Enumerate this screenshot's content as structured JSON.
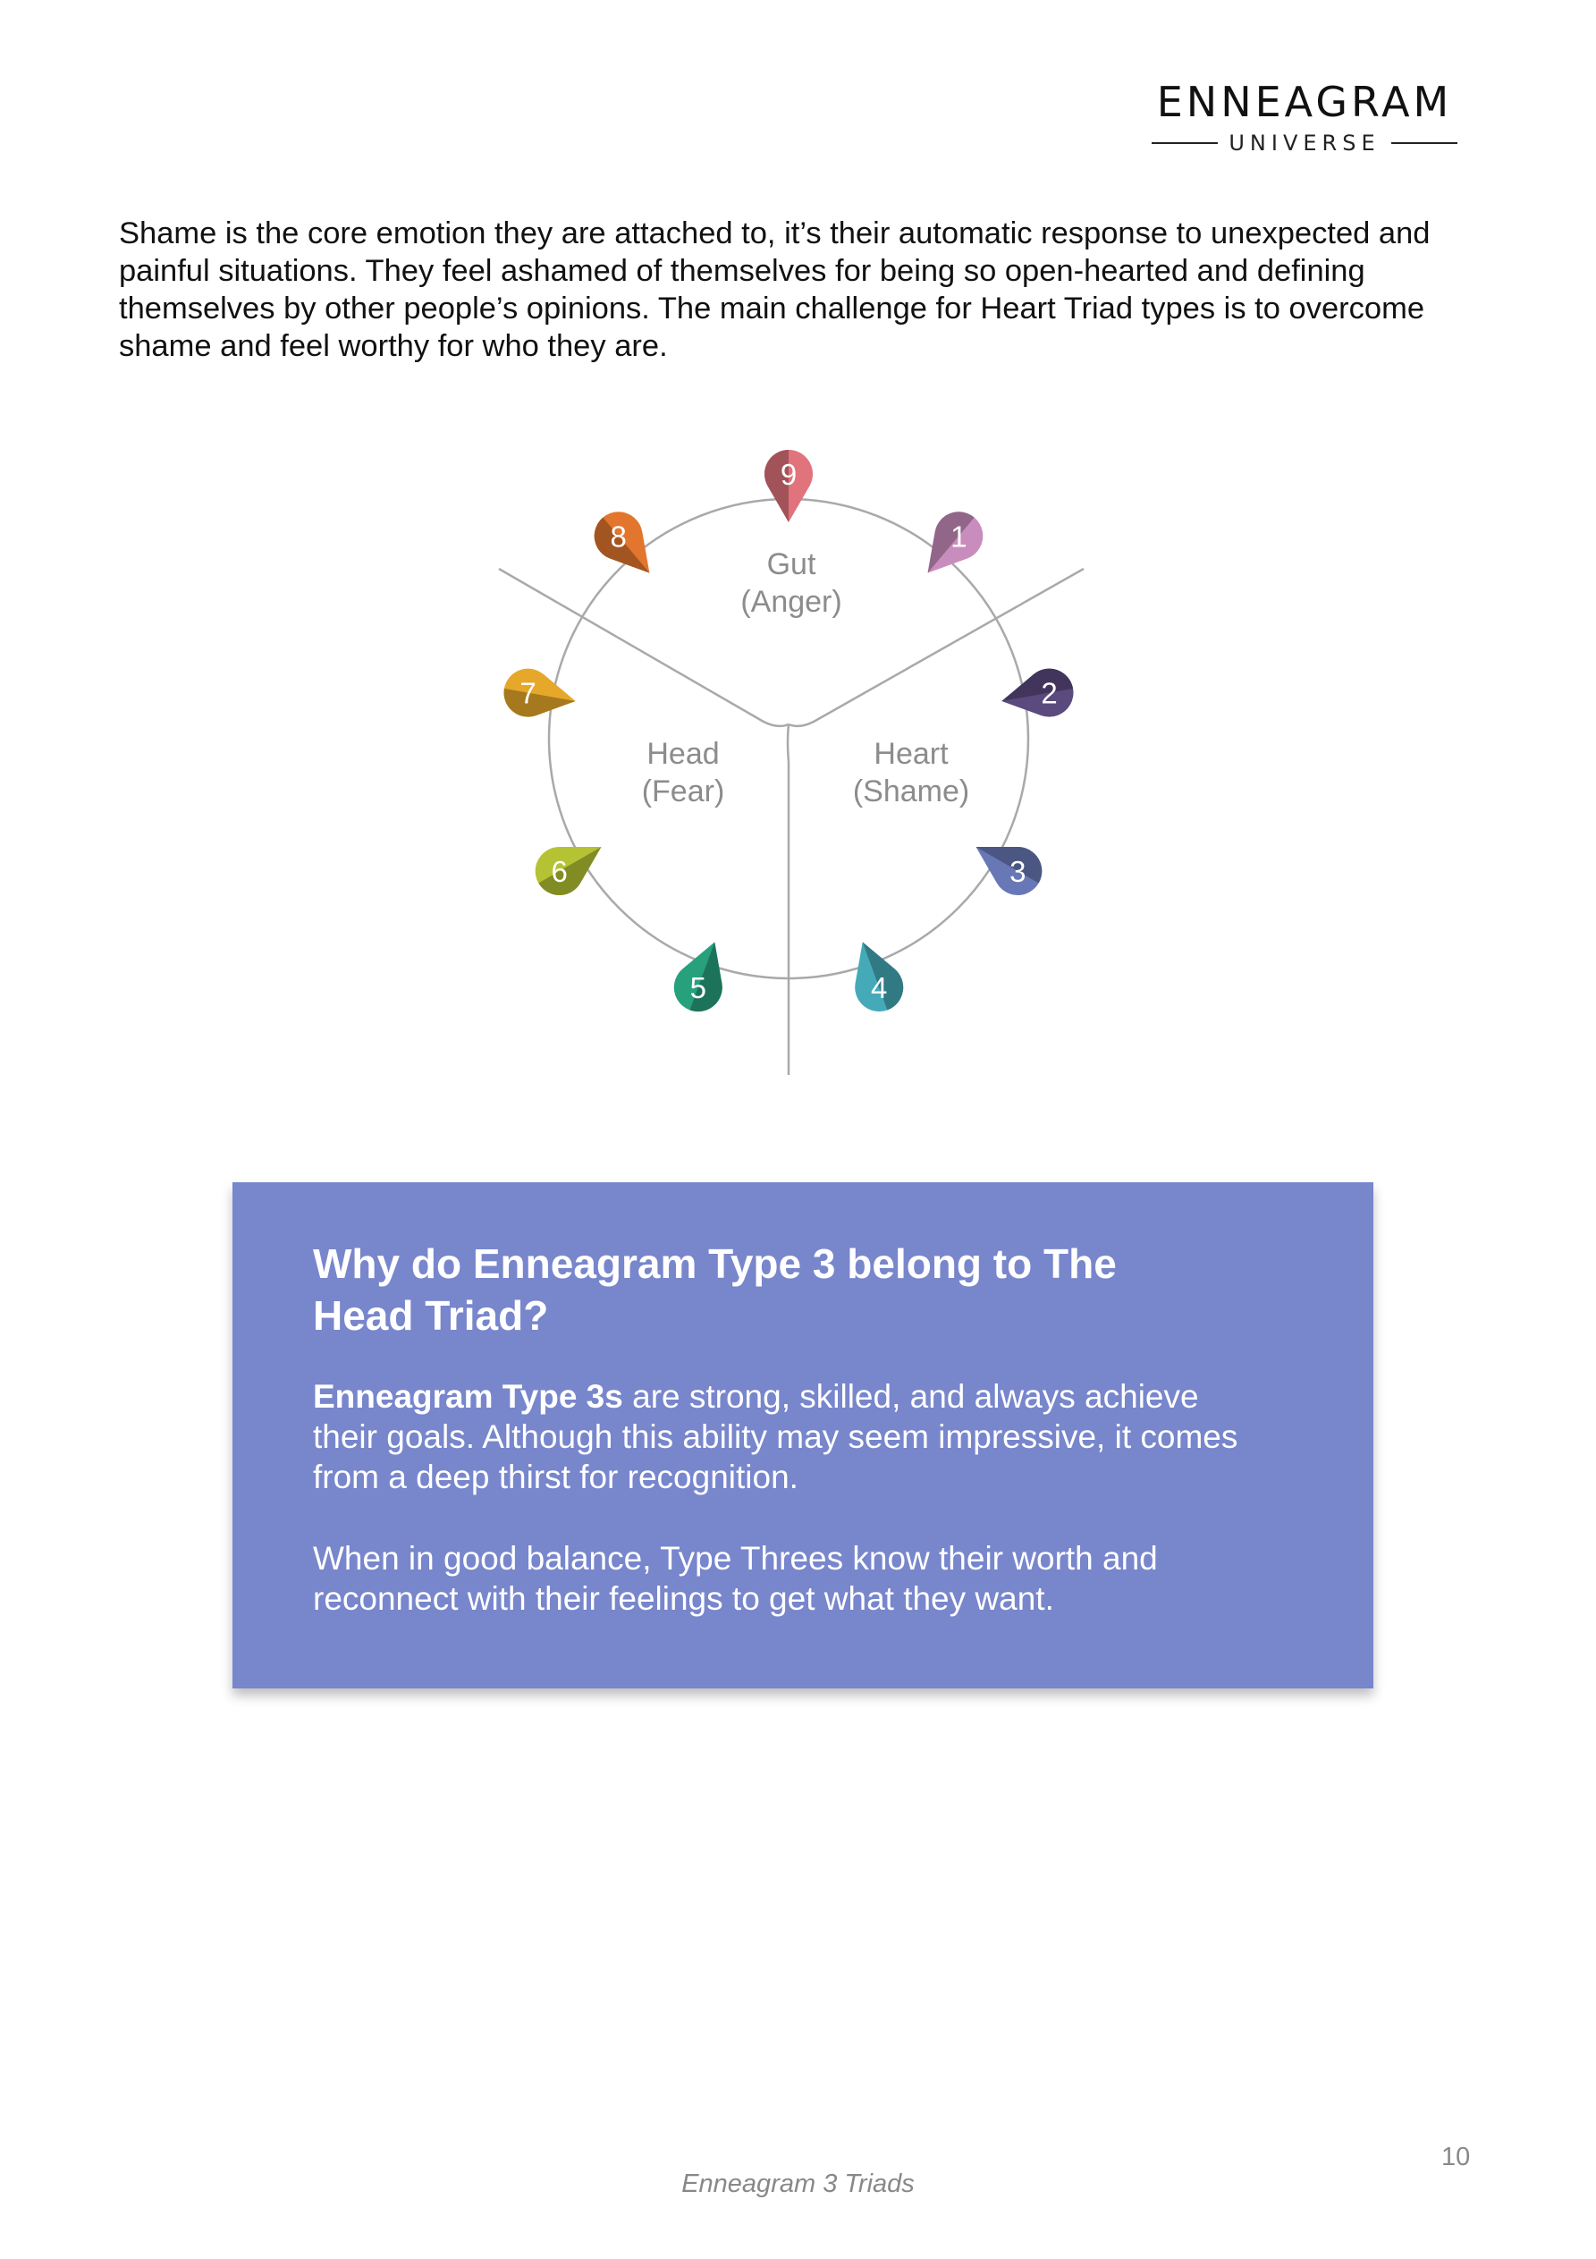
{
  "logo": {
    "title": "ENNEAGRAM",
    "subtitle": "UNIVERSE"
  },
  "intro": "Shame is the core emotion they are attached to, it’s their automatic response to unexpected and painful situations. They feel ashamed of themselves for being so open-hearted and defining themselves by other people’s opinions. The main challenge for Heart Triad types is to overcome shame and feel worthy for who they are.",
  "diagram": {
    "centers": [
      {
        "name": "Gut",
        "emotion": "(Anger)"
      },
      {
        "name": "Head",
        "emotion": "(Fear)"
      },
      {
        "name": "Heart",
        "emotion": "(Shame)"
      }
    ],
    "types": [
      {
        "number": "9",
        "color": "#e0737b"
      },
      {
        "number": "1",
        "color": "#c98dbd"
      },
      {
        "number": "2",
        "color": "#5b4a7e"
      },
      {
        "number": "3",
        "color": "#6878b6"
      },
      {
        "number": "4",
        "color": "#44aab8"
      },
      {
        "number": "5",
        "color": "#27a07c"
      },
      {
        "number": "6",
        "color": "#b4c234"
      },
      {
        "number": "7",
        "color": "#e6a82a"
      },
      {
        "number": "8",
        "color": "#e2762e"
      }
    ]
  },
  "box": {
    "title": "Why do Enneagram Type 3 belong to The Head Triad?",
    "para1_bold": "Enneagram Type 3s",
    "para1_rest": " are strong, skilled, and always achieve their goals. Although this ability may seem impressive, it comes from a deep thirst for recognition.",
    "para2": "When in good balance, Type Threes know their worth and reconnect with their feelings to get what they want."
  },
  "footer": {
    "page_number": "10",
    "title": "Enneagram 3 Triads"
  }
}
